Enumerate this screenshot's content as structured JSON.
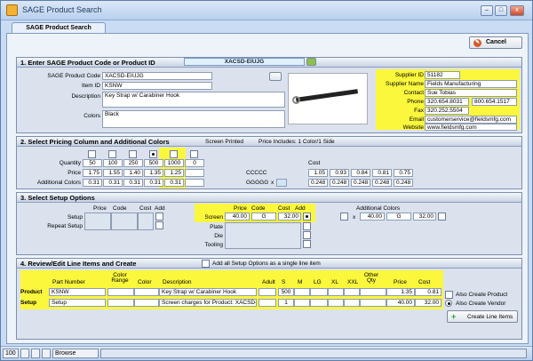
{
  "window": {
    "title": "SAGE Product Search",
    "min": "–",
    "max": "□",
    "close": "x"
  },
  "tabs": [
    {
      "label": "SAGE Product Search"
    }
  ],
  "toolbar": {
    "cancel_label": "Cancel"
  },
  "s1": {
    "heading": "1. Enter SAGE Product Code or Product ID",
    "code_search_value": "XACSD-EIUJG",
    "product_code_label": "SAGE Product Code",
    "product_code": "XACSD-EIUJG",
    "item_id_label": "Item ID",
    "item_id": "KSNW",
    "description_label": "Description",
    "description": "Key Strap w/ Carabiner Hook",
    "colors_label": "Colors",
    "colors": "Black",
    "supplier": {
      "id_label": "Supplier ID",
      "id": "51182",
      "name_label": "Supplier Name",
      "name": "Fields Manufacturing",
      "contact_label": "Contact",
      "contact": "Sue Tobias",
      "phone_label": "Phone",
      "phone1": "320.654.8031",
      "phone2": "800.654.1517",
      "fax_label": "Fax",
      "fax": "320.252.5504",
      "email_label": "Email",
      "email": "customerservice@fieldsmfg.com",
      "website_label": "Website",
      "website": "www.fieldsmfg.com"
    }
  },
  "s2": {
    "heading": "2. Select Pricing Column and Additional Colors",
    "screen_printed": "Screen Printed",
    "price_includes": "Price Includes: 1 Color/1 Side",
    "quantity_label": "Quantity",
    "price_label": "Price",
    "addl_colors_label": "Additional Colors",
    "quantities": [
      "50",
      "100",
      "250",
      "500",
      "1000",
      "0"
    ],
    "prices": [
      "1.75",
      "1.55",
      "1.40",
      "1.35",
      "1.25",
      ""
    ],
    "addl_colors": [
      "0.31",
      "0.31",
      "0.31",
      "0.31",
      "0.31",
      ""
    ],
    "price_code": "CCCCC",
    "addl_code": "GGGGG",
    "x_label": "x",
    "cost_label": "Cost",
    "costs": [
      "1.05",
      "0.93",
      "0.84",
      "0.81",
      "0.75"
    ],
    "addl_costs": [
      "0.248",
      "0.248",
      "0.248",
      "0.248",
      "0.248"
    ]
  },
  "s3": {
    "heading": "3. Select Setup Options",
    "col_price": "Price",
    "col_code": "Code",
    "col_cost": "Cost",
    "col_add": "Add",
    "setup_label": "Setup",
    "repeat_label": "Repeat Setup",
    "screen_label": "Screen",
    "plate_label": "Plate",
    "die_label": "Die",
    "tooling_label": "Tooling",
    "screen_price": "40.00",
    "screen_code": "G",
    "screen_cost": "32.00",
    "addl_colors_label": "Additional Colors",
    "addl_x": "x",
    "addl_price": "40.00",
    "addl_code": "G",
    "addl_cost": "32.00"
  },
  "s4": {
    "heading": "4. Review/Edit Line Items and Create",
    "add_all_setup": "Add all Setup Options as a single line item",
    "headers": {
      "part": "Part Number",
      "color_range": "Color Range",
      "color": "Color",
      "description": "Description",
      "adult": "Adult",
      "s": "S",
      "m": "M",
      "lg": "LG",
      "xl": "XL",
      "xxl": "XXL",
      "other_qty": "Other Qty",
      "price": "Price",
      "cost": "Cost"
    },
    "rows": [
      {
        "label": "Product",
        "part": "KSNW",
        "description": "Key Strap w/ Carabiner Hook",
        "s": "500",
        "price": "1.35",
        "cost": "0.81"
      },
      {
        "label": "Setup",
        "part": "Setup",
        "description": "Screen charges for Product: XACSD-",
        "s": "1",
        "price": "40.00",
        "cost": "32.00"
      }
    ],
    "also_product": "Also Create Product",
    "also_vendor": "Also Create Vendor",
    "create_btn": "Create Line Items"
  },
  "statusbar": {
    "zoom": "100",
    "mode": "Browse"
  }
}
